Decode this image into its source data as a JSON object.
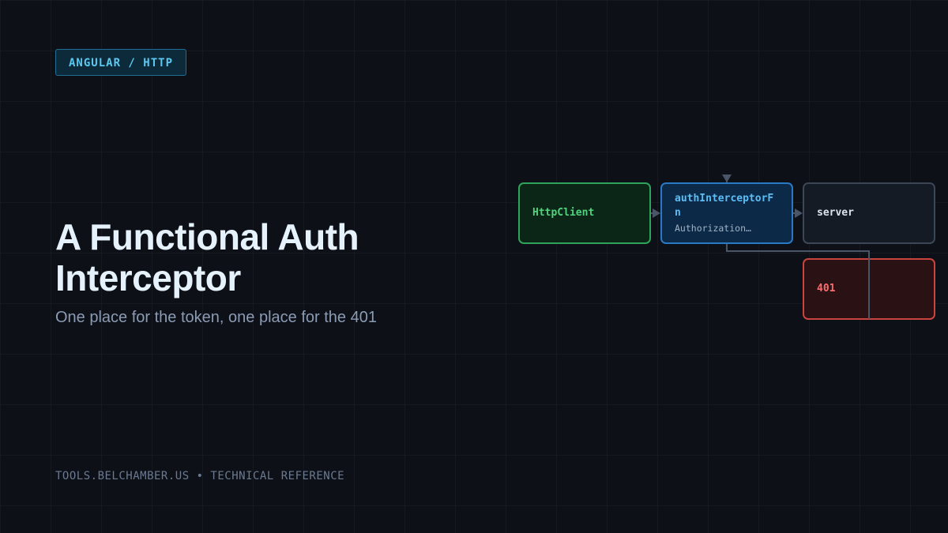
{
  "badge": "ANGULAR / HTTP",
  "title": "A Functional Auth Interceptor",
  "subtitle": "One place for the token, one place for the 401",
  "footer": "TOOLS.BELCHAMBER.US • TECHNICAL REFERENCE",
  "diagram": {
    "nodes": {
      "client": {
        "label": "HttpClient"
      },
      "interceptor": {
        "label": "authInterceptorFn",
        "sublabel": "Authorization…"
      },
      "server": {
        "label": "server"
      },
      "unauthorized": {
        "label": "401"
      }
    },
    "edges": [
      {
        "from": "HttpClient",
        "to": "authInterceptorFn"
      },
      {
        "from": "authInterceptorFn",
        "to": "server"
      },
      {
        "from": "401",
        "to": "authInterceptorFn"
      }
    ]
  },
  "colors": {
    "background": "#0d1117",
    "accent": "#5cc8f0",
    "client": "#4fd37c",
    "interceptor": "#5cbcf5",
    "error": "#ff6b6b",
    "connector": "#4a5668"
  }
}
